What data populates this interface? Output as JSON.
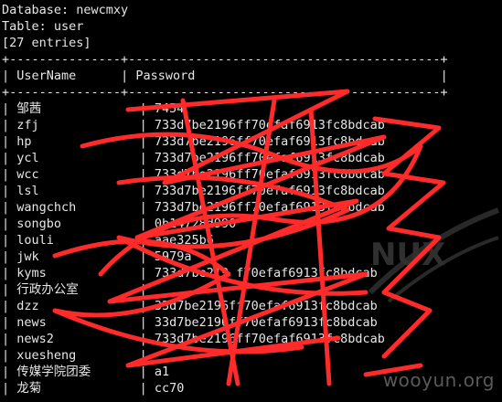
{
  "header": {
    "database": "Database: newcmxy",
    "table": "Table: user",
    "entries": "[27 entries]"
  },
  "table": {
    "border": "+---------------+------------------------------------------+",
    "columns": [
      "UserName",
      "Password"
    ],
    "rows": [
      {
        "user": "邹茜",
        "pass": "7454"
      },
      {
        "user": "zfj",
        "pass": "733d7be2196ff70efaf6913fc8bdcab"
      },
      {
        "user": "hp",
        "pass": "733d7be2196ff70efaf6913fc8bdcab"
      },
      {
        "user": "ycl",
        "pass": "733d7be2196ff70efaf6913fc8bdcab"
      },
      {
        "user": "wcc",
        "pass": "733d7be2196ff70efaf6913fc8bdcab"
      },
      {
        "user": "lsl",
        "pass": "733d7be2196ff70efaf6913fc8bdcab"
      },
      {
        "user": "wangchch",
        "pass": "733d7be2196ff70efaf6913fc8bdcab"
      },
      {
        "user": "songbo",
        "pass": "0b14728d990"
      },
      {
        "user": "louli",
        "pass": "aae325b6"
      },
      {
        "user": "jwk",
        "pass": "5979a"
      },
      {
        "user": "kyms",
        "pass": "733d7be219 f70efaf6913fc8bdcab"
      },
      {
        "user": "行政办公室",
        "pass": ""
      },
      {
        "user": "dzz",
        "pass": "33d7be2196ff70efaf6913fc8bdcab"
      },
      {
        "user": "news",
        "pass": "33d7be2196ff70efaf6913fc8bdcab"
      },
      {
        "user": "news2",
        "pass": "733d7be2196ff70efaf6913fc8bdcab"
      },
      {
        "user": "xuesheng",
        "pass": ""
      },
      {
        "user": "传媒学院团委",
        "pass": "a1"
      },
      {
        "user": "龙菊",
        "pass": "cc70"
      }
    ]
  },
  "watermark": "wooyun.org",
  "colors": {
    "scribble": "#ff2a2a",
    "background": "#000000",
    "text": "#e6e6e6"
  }
}
